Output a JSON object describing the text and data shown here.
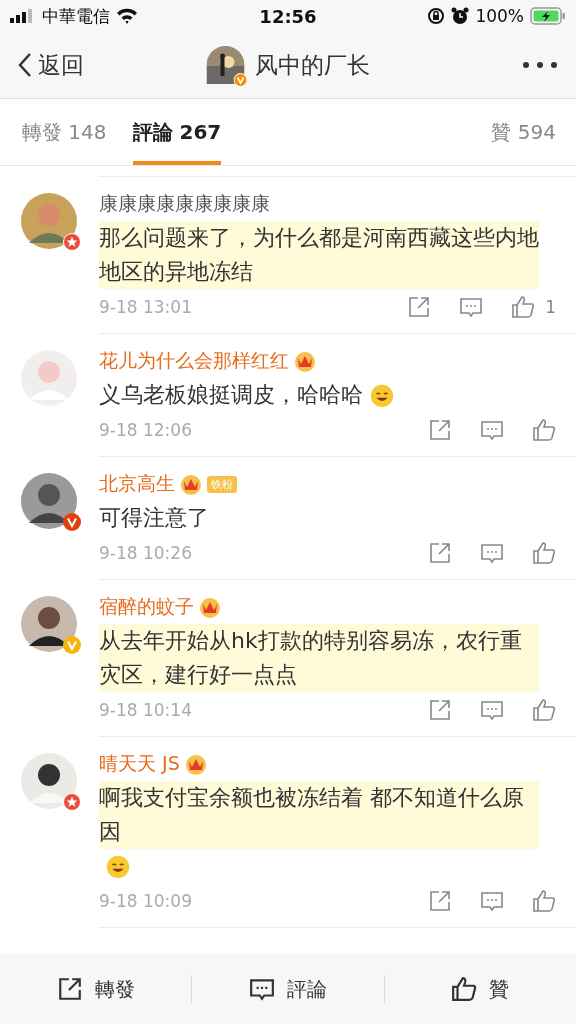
{
  "status_bar": {
    "carrier": "中華電信",
    "time": "12:56",
    "battery": "100%"
  },
  "nav": {
    "back": "返回",
    "title": "风中的厂长"
  },
  "tabs": [
    {
      "label": "轉發 148",
      "selected": false
    },
    {
      "label": "評論 267",
      "selected": true
    },
    {
      "label": "贊 594",
      "selected": false
    }
  ],
  "comments": [
    {
      "name": "康康康康康康康康康",
      "vip": false,
      "avatar_badge": {
        "kind": "star"
      },
      "crown": false,
      "text": "那么问题来了，为什么都是河南西藏这些内地地区的异地冻结",
      "emoji": false,
      "highlighted": true,
      "time": "9-18 13:01",
      "likes": "1"
    },
    {
      "name": "花儿为什么会那样红红",
      "vip": true,
      "avatar_badge": {
        "kind": "none"
      },
      "crown": true,
      "text": "义乌老板娘挺调皮，哈哈哈",
      "emoji": true,
      "highlighted": false,
      "time": "9-18 12:06"
    },
    {
      "name": "北京高生",
      "vip": true,
      "avatar_badge": {
        "kind": "verified",
        "color": "#e0400e"
      },
      "crown": true,
      "fan_tag": "铁粉",
      "text": "可得注意了",
      "emoji": false,
      "highlighted": false,
      "time": "9-18 10:26"
    },
    {
      "name": "宿醉的蚊子",
      "vip": true,
      "avatar_badge": {
        "kind": "verified",
        "color": "#f5b50c"
      },
      "crown": true,
      "text": "从去年开始从hk打款的特别容易冻，农行重灾区，建行好一点点",
      "emoji": false,
      "highlighted": true,
      "time": "9-18 10:14"
    },
    {
      "name": "晴天天 JS",
      "vip": true,
      "avatar_badge": {
        "kind": "star"
      },
      "crown": true,
      "text": "啊我支付宝余额也被冻结着 都不知道什么原因",
      "emoji": true,
      "highlighted": true,
      "time": "9-18 10:09"
    }
  ],
  "bottom_bar": [
    {
      "kind": "share",
      "label": "轉發"
    },
    {
      "kind": "comment",
      "label": "評論"
    },
    {
      "kind": "like",
      "label": "贊"
    }
  ]
}
